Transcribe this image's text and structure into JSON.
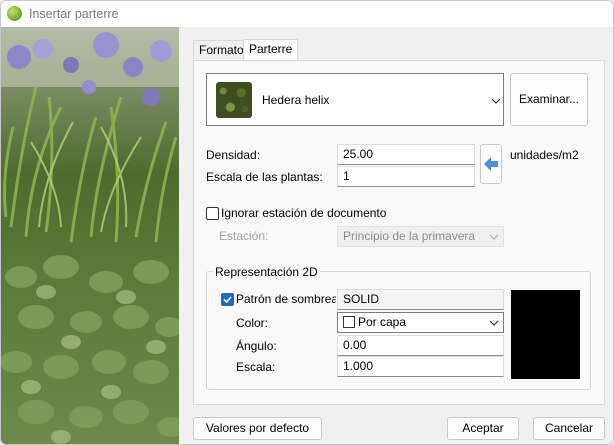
{
  "window": {
    "title": "Insertar parterre"
  },
  "tabs": [
    {
      "label": "Formato"
    },
    {
      "label": "Parterre"
    }
  ],
  "plant": {
    "name": "Hedera helix",
    "browse_label": "Examinar..."
  },
  "density": {
    "label": "Densidad:",
    "value": "25.00",
    "unit": "unidades/m2"
  },
  "scale": {
    "label": "Escala de las plantas:",
    "value": "1"
  },
  "ignore_station": {
    "label": "Ignorar estación de documento",
    "checked": false
  },
  "station": {
    "label": "Estación:",
    "value": "Principio de la primavera"
  },
  "representation": {
    "title": "Representación 2D",
    "hatch_label": "Patrón de sombreado",
    "hatch_checked": true,
    "hatch_value": "SOLID",
    "color_label": "Color:",
    "color_value": "Por capa",
    "angle_label": "Ángulo:",
    "angle_value": "0.00",
    "scale_label": "Escala:",
    "scale_value": "1.000",
    "preview_color": "#000000"
  },
  "footer": {
    "defaults_label": "Valores por defecto",
    "ok_label": "Aceptar",
    "cancel_label": "Cancelar"
  },
  "colors": {
    "accent": "#1f6bc1",
    "arrow": "#4a90d9"
  }
}
